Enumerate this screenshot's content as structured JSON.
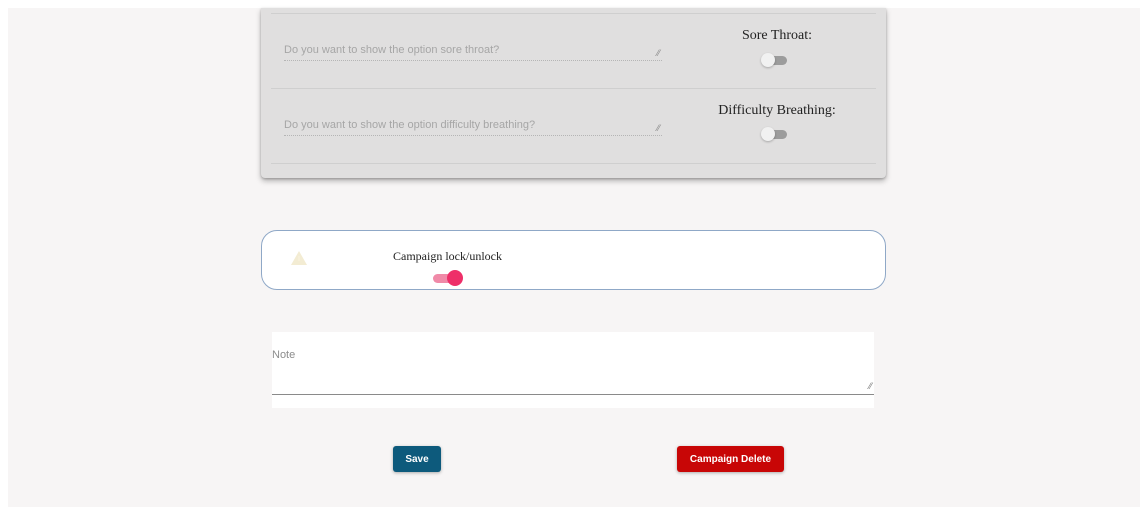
{
  "symptom_options": [
    {
      "question_placeholder": "Do you want to show the option sore throat?",
      "label": "Sore Throat:",
      "enabled": false
    },
    {
      "question_placeholder": "Do you want to show the option difficulty breathing?",
      "label": "Difficulty Breathing:",
      "enabled": false
    }
  ],
  "campaign_lock": {
    "icon": "warning-icon",
    "label": "Campaign lock/unlock",
    "enabled": true,
    "accent_color": "#ee2f69"
  },
  "note": {
    "label": "Note",
    "value": ""
  },
  "actions": {
    "save_label": "Save",
    "save_color": "#0d5a7c",
    "delete_label": "Campaign Delete",
    "delete_color": "#c80606"
  }
}
